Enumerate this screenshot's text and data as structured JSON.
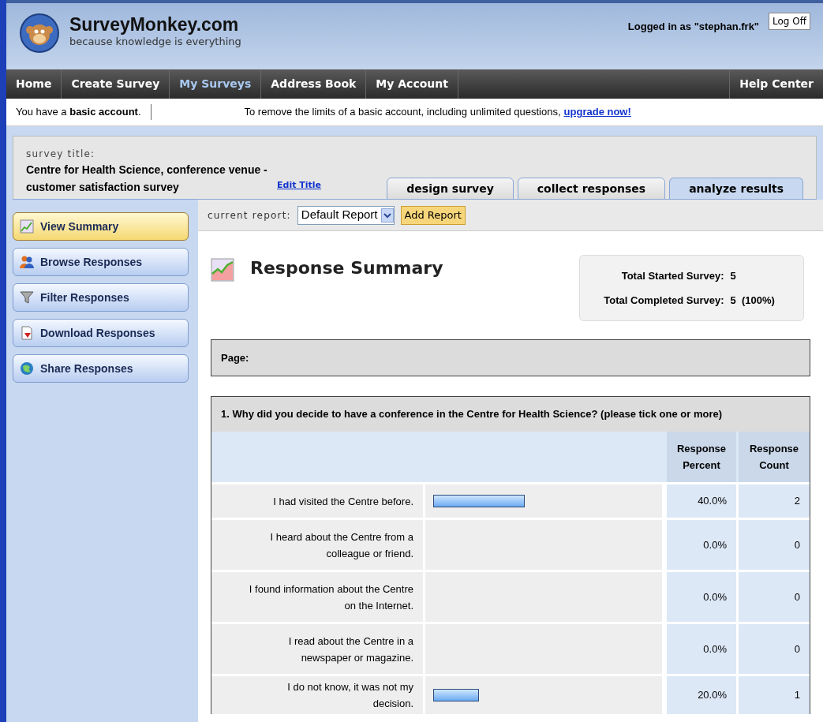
{
  "header": {
    "site_name": "SurveyMonkey.com",
    "tagline": "because knowledge is everything",
    "logged_in": "Logged in as \"stephan.frk\"",
    "log_off": "Log Off"
  },
  "nav": [
    {
      "label": "Home",
      "selected": false
    },
    {
      "label": "Create Survey",
      "selected": false
    },
    {
      "label": "My Surveys",
      "selected": true
    },
    {
      "label": "Address Book",
      "selected": false
    },
    {
      "label": "My Account",
      "selected": false
    }
  ],
  "help_center": "Help Center",
  "account_bar": {
    "notice": "You have a **basic account**.",
    "message": "To remove the limits of a basic account, including unlimited questions,",
    "link": "upgrade now!"
  },
  "survey": {
    "label": "survey title:",
    "title": "Centre for Health Science, conference venue - customer satisfaction survey",
    "edit_link": "Edit Title"
  },
  "tabs": [
    {
      "label": "design survey",
      "selected": false
    },
    {
      "label": "collect responses",
      "selected": false
    },
    {
      "label": "analyze results",
      "selected": true
    }
  ],
  "sidebar": {
    "items": [
      {
        "label": "View Summary",
        "kind": "chart",
        "selected": true
      },
      {
        "label": "Browse Responses",
        "kind": "people",
        "selected": false
      },
      {
        "label": "Filter Responses",
        "kind": "filter",
        "selected": false
      },
      {
        "label": "Download Responses",
        "kind": "download",
        "selected": false
      },
      {
        "label": "Share Responses",
        "kind": "share",
        "selected": false
      }
    ]
  },
  "report_bar": {
    "label": "current report:",
    "value": "Default Report",
    "button": "Add Report"
  },
  "summary": {
    "title": "Response Summary",
    "stats": [
      {
        "label": "Total Started Survey:",
        "value": "5"
      },
      {
        "label": "Total Completed Survey:",
        "value": "5  (100%)"
      }
    ]
  },
  "page_label": "Page:",
  "question": {
    "text": "1. Why did you decide to have a conference in the Centre for Health Science? (please tick one or more)",
    "columns": [
      "Response Percent",
      "Response Count"
    ],
    "rows": [
      {
        "answer": "I had visited the Centre before.",
        "percent": "40.0%",
        "count": "2"
      },
      {
        "answer": "I heard about the Centre from a colleague or friend.",
        "percent": "0.0%",
        "count": "0"
      },
      {
        "answer": "I found information about the Centre on the Internet.",
        "percent": "0.0%",
        "count": "0"
      },
      {
        "answer": "I read about the Centre in a newspaper or magazine.",
        "percent": "0.0%",
        "count": "0"
      },
      {
        "answer": "I do not know, it was not my decision.",
        "percent": "20.0%",
        "count": "1"
      }
    ]
  }
}
